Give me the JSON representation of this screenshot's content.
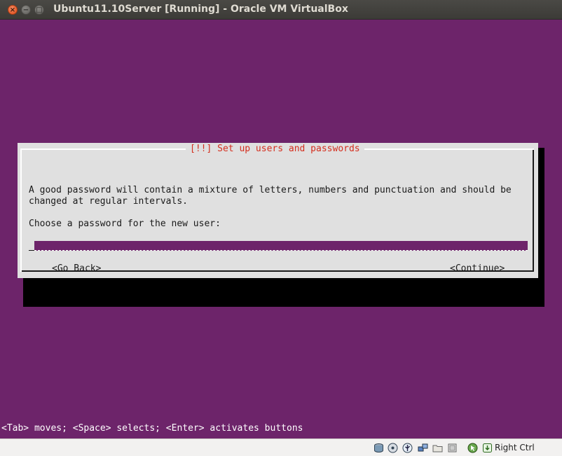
{
  "window": {
    "title": "Ubuntu11.10Server [Running] - Oracle VM VirtualBox",
    "buttons": {
      "close": "×",
      "minimize": "−",
      "maximize": "□"
    }
  },
  "dialog": {
    "title": "[!!] Set up users and passwords",
    "description": "A good password will contain a mixture of letters, numbers and punctuation and should be\nchanged at regular intervals.",
    "prompt": "Choose a password for the new user:",
    "password_value": "",
    "back_label": "<Go Back>",
    "continue_label": "<Continue>"
  },
  "footer_hint": "<Tab> moves; <Space> selects; <Enter> activates buttons",
  "statusbar": {
    "icons": [
      "hard-disk-icon",
      "optical-drive-icon",
      "usb-icon",
      "network-icon",
      "shared-folders-icon",
      "video-capture-icon",
      "mouse-integration-icon",
      "keyboard-capture-icon"
    ],
    "host_key": "Right Ctrl"
  },
  "colors": {
    "screen_bg": "#6d246a",
    "dialog_bg": "#e0e0e0",
    "dialog_title": "#d42f1f",
    "titlebar": "#3c3b37"
  }
}
